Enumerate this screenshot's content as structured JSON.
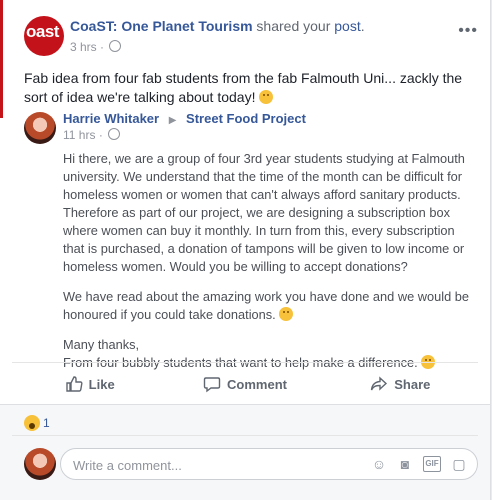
{
  "post": {
    "org_name": "CoaST: One Planet Tourism",
    "shared_text": " shared your ",
    "post_link": "post",
    "post_link_suffix": ".",
    "time": "3 hrs",
    "meta_sep": "·",
    "logo_text": "oast",
    "message": "Fab idea from four fab students from the fab Falmouth Uni... zackly the sort of idea we're talking about today!"
  },
  "shared": {
    "author": "Harrie Whitaker",
    "arrow": "▶",
    "group": "Street Food Project",
    "time": "11 hrs",
    "meta_sep": "·",
    "paragraph1": "Hi there, we are a group of four 3rd year students studying at Falmouth university. We understand that the time of the month can be difficult for homeless women or women that can't always afford sanitary products. Therefore as part of our project, we are designing a subscription box where women can buy it monthly. In turn from this, every subscription that is purchased, a donation of tampons will be given to low income or homeless women. Would you be willing to accept donations?",
    "paragraph2": "We have read about the amazing work you have done and we would be honoured if you could take donations.",
    "paragraph3_line1": "Many thanks,",
    "paragraph3_line2": "From four bubbly students that want to help make a difference."
  },
  "actions": {
    "like": "Like",
    "comment": "Comment",
    "share": "Share"
  },
  "reactions": {
    "count": "1",
    "type": "wow-icon"
  },
  "comment": {
    "placeholder": "Write a comment..."
  },
  "colors": {
    "link": "#365899",
    "brand_red": "#c4121a",
    "muted": "#90949c"
  }
}
